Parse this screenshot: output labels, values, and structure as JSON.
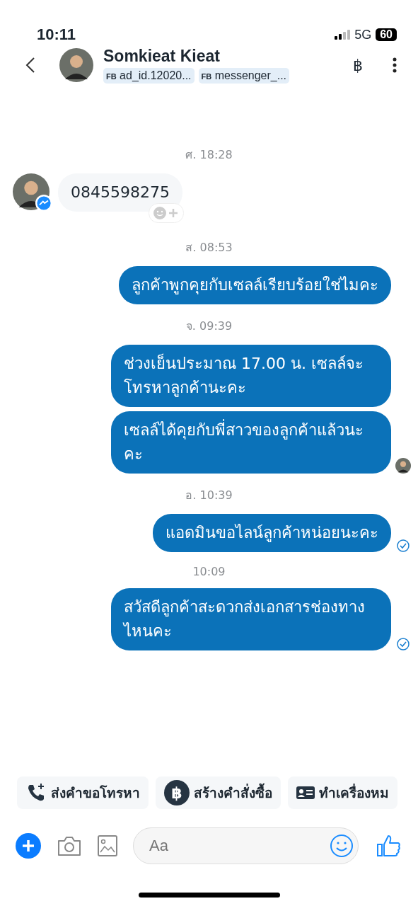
{
  "status_bar": {
    "time": "10:11",
    "network": "5G",
    "battery": "60"
  },
  "header": {
    "name": "Somkieat Kieat",
    "tags": [
      {
        "prefix": "FB",
        "label": "ad_id.12020..."
      },
      {
        "prefix": "FB",
        "label": "messenger_..."
      }
    ],
    "currency": "฿"
  },
  "messages": [
    {
      "kind": "time",
      "text": "ศ. 18:28"
    },
    {
      "kind": "incoming",
      "text": "0845598275"
    },
    {
      "kind": "time",
      "text": "ส. 08:53"
    },
    {
      "kind": "outgoing",
      "text": "ลูกค้าพูกคุยกับเซลล์เรียบร้อยใช่ไมคะ",
      "seen": false,
      "sent": false
    },
    {
      "kind": "time",
      "text": "จ. 09:39"
    },
    {
      "kind": "outgoing",
      "text": "ช่วงเย็นประมาณ 17.00 น.  เซลล์จะโทรหาลูกค้านะคะ",
      "seen": false,
      "sent": false
    },
    {
      "kind": "outgoing",
      "text": "เซลล์ได้คุยกับพี่สาวของลูกค้าแล้วนะคะ",
      "seen": true,
      "sent": false
    },
    {
      "kind": "time",
      "text": "อ. 10:39"
    },
    {
      "kind": "outgoing",
      "text": "แอดมินขอไลน์ลูกค้าหน่อยนะคะ",
      "seen": false,
      "sent": true
    },
    {
      "kind": "time",
      "text": "10:09"
    },
    {
      "kind": "outgoing",
      "text": "สวัสดีลูกค้าสะดวกส่งเอกสารช่องทางไหนคะ",
      "seen": false,
      "sent": true
    }
  ],
  "actions": [
    {
      "kind": "call",
      "label": "ส่งคำขอโทรหา"
    },
    {
      "kind": "order",
      "label": "สร้างคำสั่งซื้อ",
      "icon_text": "฿"
    },
    {
      "kind": "card",
      "label": "ทำเครื่องหม"
    }
  ],
  "composer": {
    "placeholder": "Aa"
  }
}
